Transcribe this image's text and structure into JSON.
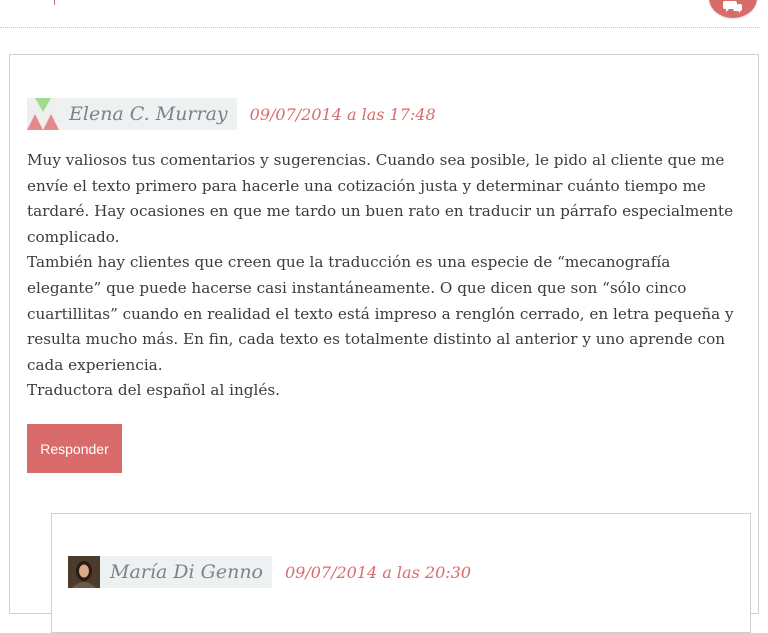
{
  "header": {
    "comments_icon": "comments-bubble-icon"
  },
  "comment": {
    "author": "Elena C. Murray",
    "date": "09/07/2014 a las 17:48",
    "avatar": "geometric-avatar-icon",
    "paragraphs": [
      "Muy valiosos tus comentarios y sugerencias. Cuando sea posible, le pido al cliente que me envíe el texto primero para hacerle una cotización justa y determinar cuánto tiempo me tardaré. Hay ocasiones en que me tardo un buen rato en traducir un párrafo especialmente complicado.",
      "También hay clientes que creen que la traducción es una especie de “mecanografía elegante” que puede hacerse casi instantáneamente. O que dicen que son “sólo cinco cuartillitas” cuando en realidad el texto está impreso a renglón cerrado, en letra pequeña y resulta mucho más. En fin, cada texto es totalmente distinto al anterior y uno aprende con cada experiencia.",
      "Traductora del español al inglés."
    ],
    "reply_label": "Responder"
  },
  "reply": {
    "author": "María Di Genno",
    "date": "09/07/2014 a las 20:30",
    "avatar": "user-photo-avatar"
  },
  "colors": {
    "accent": "#d96b6b",
    "author_bg": "#eef1f1",
    "author_text": "#7c8486",
    "border": "#cfcfcf"
  }
}
